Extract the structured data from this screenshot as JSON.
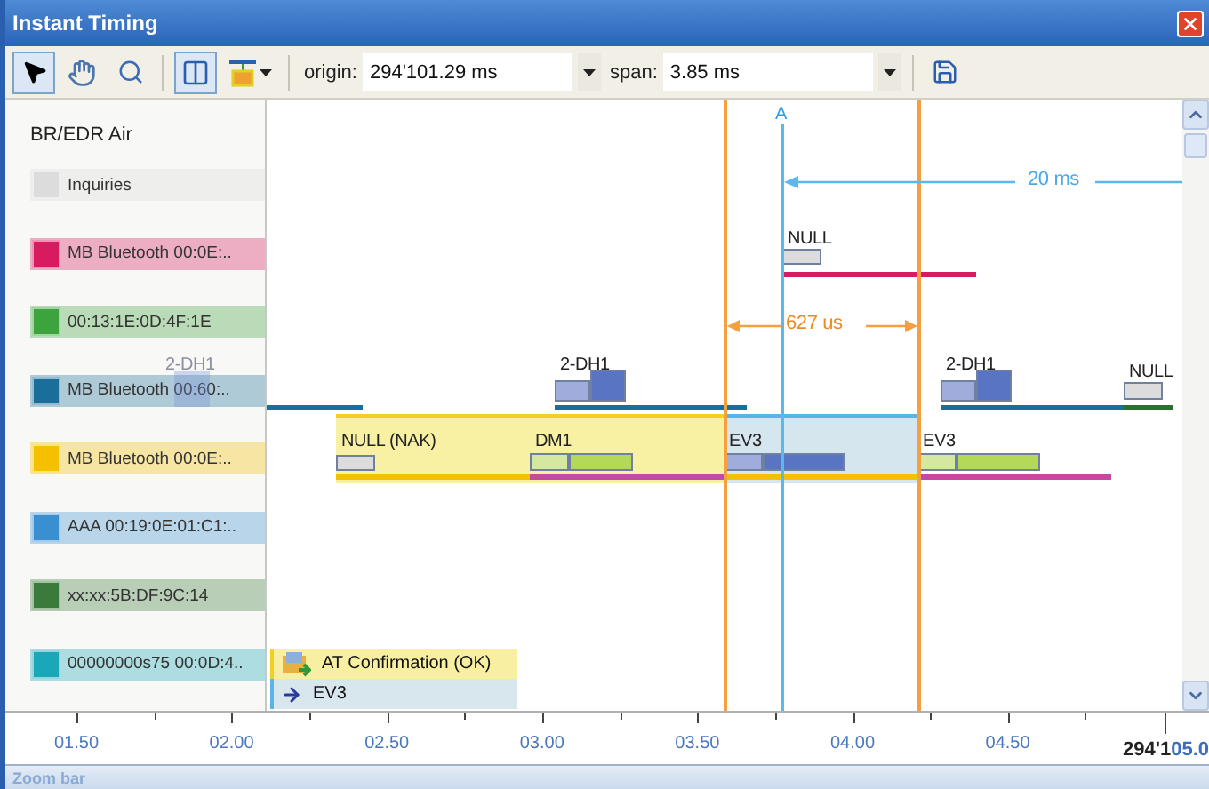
{
  "window": {
    "title": "Instant Timing"
  },
  "toolbar": {
    "tools": [
      {
        "kind": "pointer",
        "selected": true
      },
      {
        "kind": "hand",
        "selected": false
      },
      {
        "kind": "zoom",
        "selected": false
      },
      {
        "kind": "panel",
        "selected": true
      },
      {
        "kind": "marker",
        "selected": false
      }
    ],
    "origin_label": "origin:",
    "origin_value": "294'101.29 ms",
    "span_label": "span:",
    "span_value": "3.85 ms"
  },
  "lanes_header": "BR/EDR Air",
  "lanes": [
    {
      "label": "Inquiries",
      "color": "#dcdcdc"
    },
    {
      "label": "MB Bluetooth 00:0E:..",
      "color": "#d81b60",
      "packets": [
        {
          "label": "NULL"
        }
      ]
    },
    {
      "label": "00:13:1E:0D:4F:1E",
      "color": "#3da33d"
    },
    {
      "label": "MB Bluetooth 00:60:..",
      "color": "#1a6e9a",
      "packets": [
        {
          "label": "2-DH1"
        },
        {
          "label": "2-DH1"
        },
        {
          "label": "NULL"
        }
      ]
    },
    {
      "label": "MB Bluetooth 00:0E:..",
      "color": "#f5c000",
      "packets": [
        {
          "label": "NULL (NAK)"
        },
        {
          "label": "DM1"
        },
        {
          "label": "EV3"
        },
        {
          "label": "EV3"
        }
      ]
    },
    {
      "label": "AAA 00:19:0E:01:C1:..",
      "color": "#3a8fd0"
    },
    {
      "label": "xx:xx:5B:DF:9C:14",
      "color": "#3a7a3a"
    },
    {
      "label": "00000000s75 00:0D:4..",
      "color": "#1aa8b8"
    }
  ],
  "drag_ghost": {
    "label": "2-DH1"
  },
  "markers": {
    "cursor_label": "A",
    "range": "627 us",
    "interval": "20 ms"
  },
  "popup": [
    {
      "kind": "event",
      "text": "AT Confirmation (OK)"
    },
    {
      "kind": "packet",
      "text": "EV3"
    }
  ],
  "axis": {
    "ticks": [
      "01.50",
      "02.00",
      "02.50",
      "03.00",
      "03.50",
      "04.00",
      "04.50"
    ],
    "origin_prefix": "294'1",
    "origin_suffix": "05.0"
  },
  "zoom_bar": "Zoom bar"
}
